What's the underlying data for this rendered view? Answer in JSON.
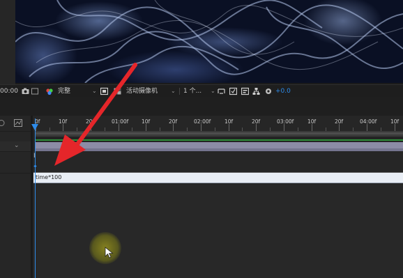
{
  "viewer": {
    "content": "smoke-footage"
  },
  "viewer_toolbar": {
    "timecode": "00:00",
    "resolution": "完整",
    "camera": "活动摄像机",
    "views": "1 个...",
    "exposure": "+0.0"
  },
  "timeline": {
    "ruler_labels": [
      "0f",
      "10f",
      "20f",
      "01:00f",
      "10f",
      "20f",
      "02:00f",
      "10f",
      "20f",
      "03:00f",
      "10f",
      "20f",
      "04:00f",
      "10f"
    ],
    "expression": "time*100"
  },
  "colors": {
    "accent_blue": "#2d8ceb",
    "annotation_red": "#e5262a",
    "work_area_green": "#2f8f3a",
    "layer_bar": "#8c8ca6"
  },
  "annotation": {
    "arrow": "red-pointer-arrow",
    "cursor": "mouse-pointer"
  }
}
